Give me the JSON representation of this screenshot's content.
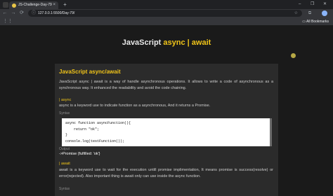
{
  "browser": {
    "tab_title": "JS-Challenge-Day-79",
    "tab_close": "×",
    "new_tab": "+",
    "window_controls": [
      "–",
      "❐",
      "✕"
    ],
    "back": "←",
    "forward": "→",
    "reload": "⟳",
    "url": "127.0.0.1:5500/Day-79/",
    "star": "☆",
    "all_bookmarks": "All Bookmarks",
    "apps_icon": "⋮⋮"
  },
  "page": {
    "title_prefix": "JavaScript ",
    "title_highlight": "async | await",
    "section_title": "JavaScript async/await",
    "intro": "JavaScript async | await is a way of handle asynchronous operations. It allows to write a code of asynchronous as a synchronous way. It enhanced the readability and avoid the code chaining.",
    "async_heading": "| async",
    "async_desc": "async is a keyword use to indicate function as a asynchronous, And it returns a Promise.",
    "syntax_label": "Syntax",
    "code_lines": [
      "async function asyncFunction(){",
      "    return \"ok\";",
      "}",
      "console.log(testFunction());"
    ],
    "output_label": "Output",
    "output_value": "->Promise {fulfilled: 'ok'}",
    "await_heading": "| await",
    "await_desc": "await is a keyword use to wait for the execution untill promise implimentation, It means promise is success(resolve) or error(rejected). Also important thing is await only can use inside the async function.",
    "syntax_label_2": "Syntax"
  }
}
